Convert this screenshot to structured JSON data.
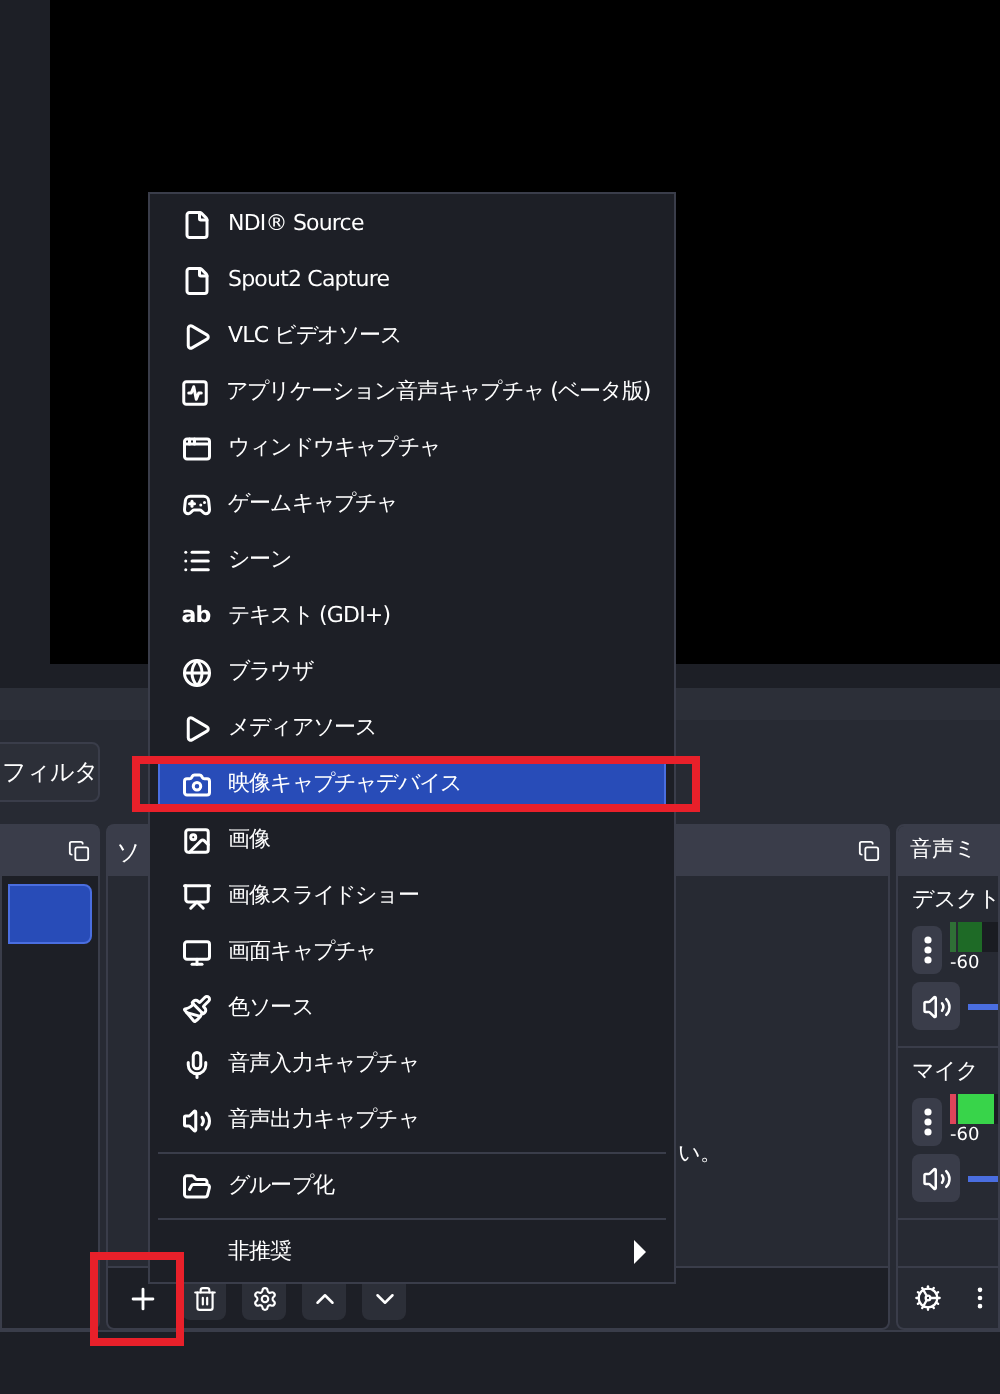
{
  "toolbar": {
    "filter_button": "フィルタ"
  },
  "scenes_dock": {
    "items": [
      {
        "selected": true
      }
    ]
  },
  "sources_dock": {
    "title": "ソ",
    "hint": "い。"
  },
  "audio_mixer": {
    "title": "音声ミ",
    "channels": [
      {
        "name": "デスクト",
        "scale": "-60",
        "meter": {
          "level": 0.6
        },
        "volume": {
          "level": 1
        },
        "muted": false,
        "clipping": false
      },
      {
        "name": "マイク",
        "scale": "-60",
        "meter": {
          "level": 0.9
        },
        "volume": {
          "level": 1
        },
        "muted": false,
        "clipping": true
      }
    ]
  },
  "add_menu": {
    "items": [
      {
        "kind": "item",
        "label": "NDI® Source",
        "selected": false
      },
      {
        "kind": "item",
        "label": "Spout2 Capture",
        "selected": false
      },
      {
        "kind": "item",
        "label": "VLC ビデオソース",
        "selected": false
      },
      {
        "kind": "item",
        "label": "アプリケーション音声キャプチャ (ベータ版)",
        "selected": false
      },
      {
        "kind": "item",
        "label": "ウィンドウキャプチャ",
        "selected": false
      },
      {
        "kind": "item",
        "label": "ゲームキャプチャ",
        "selected": false
      },
      {
        "kind": "item",
        "label": "シーン",
        "selected": false
      },
      {
        "kind": "item",
        "label": "テキスト (GDI+)",
        "glyph": "ab",
        "selected": false
      },
      {
        "kind": "item",
        "label": "ブラウザ",
        "selected": false
      },
      {
        "kind": "item",
        "label": "メディアソース",
        "selected": false
      },
      {
        "kind": "item",
        "label": "映像キャプチャデバイス",
        "selected": true
      },
      {
        "kind": "item",
        "label": "画像",
        "selected": false
      },
      {
        "kind": "item",
        "label": "画像スライドショー",
        "selected": false
      },
      {
        "kind": "item",
        "label": "画面キャプチャ",
        "selected": false
      },
      {
        "kind": "item",
        "label": "色ソース",
        "selected": false
      },
      {
        "kind": "item",
        "label": "音声入力キャプチャ",
        "selected": false
      },
      {
        "kind": "item",
        "label": "音声出力キャプチャ",
        "selected": false
      },
      {
        "kind": "separator"
      },
      {
        "kind": "item",
        "label": "グループ化",
        "selected": false
      },
      {
        "kind": "separator"
      },
      {
        "kind": "submenu",
        "label": "非推奨",
        "selected": false
      }
    ]
  }
}
